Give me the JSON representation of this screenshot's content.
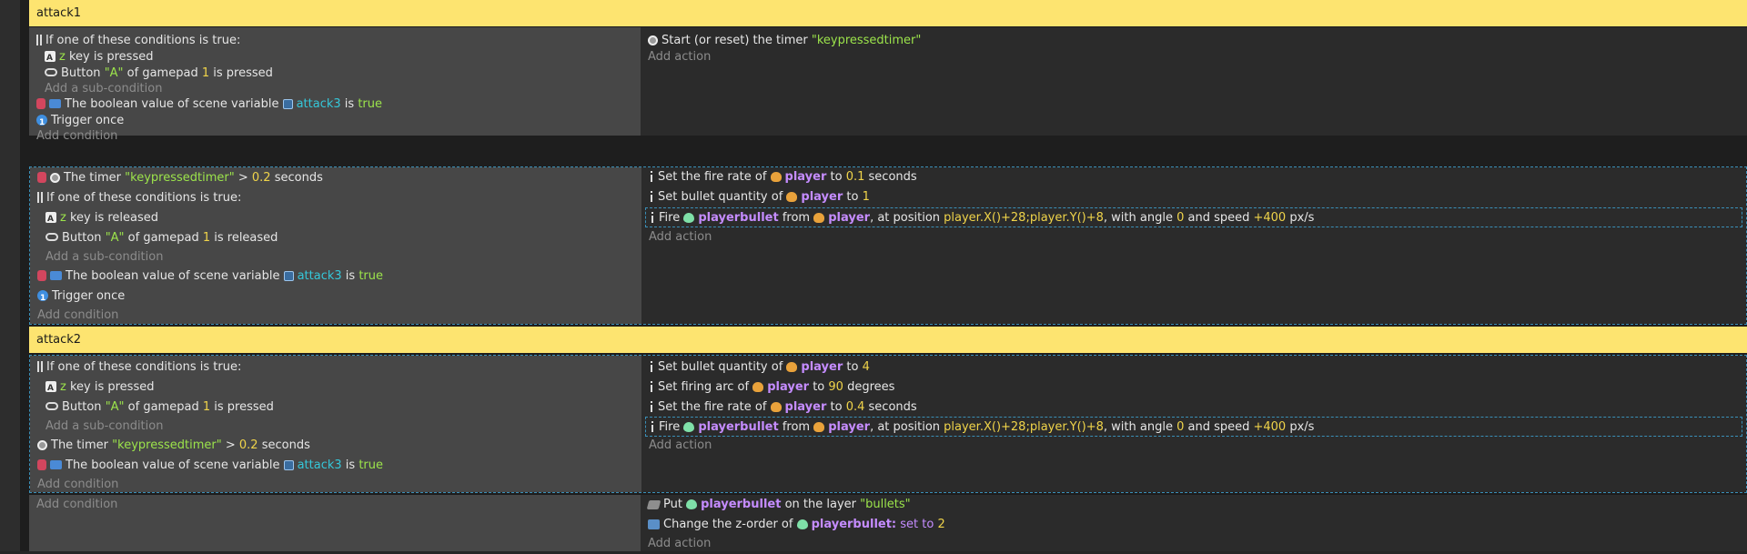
{
  "attack1": {
    "header": "attack1",
    "event1": {
      "or_label": "If one of these conditions is true:",
      "key_name": "z",
      "key_suffix": " key is pressed",
      "pad_prefix": "Button ",
      "pad_button": "\"A\"",
      "pad_mid": " of gamepad ",
      "pad_num": "1",
      "pad_suffix": " is pressed",
      "add_sub": "Add a sub-condition",
      "bool_prefix": "The boolean value of scene variable ",
      "bool_var": "attack3",
      "bool_mid": " is ",
      "bool_val": "true",
      "trigger": "Trigger once",
      "add_cond": "Add condition",
      "action_prefix": "Start (or reset) the timer ",
      "timer_name": "\"keypressedtimer\"",
      "add_action": "Add action"
    },
    "event2": {
      "timer_prefix": "The timer ",
      "timer_name": "\"keypressedtimer\"",
      "timer_op": " > ",
      "timer_val": "0.2",
      "timer_suffix": " seconds",
      "or_label": "If one of these conditions is true:",
      "key_name": "z",
      "key_suffix": " key is released",
      "pad_prefix": "Button ",
      "pad_button": "\"A\"",
      "pad_mid": " of gamepad ",
      "pad_num": "1",
      "pad_suffix": " is released",
      "add_sub": "Add a sub-condition",
      "bool_prefix": "The boolean value of scene variable ",
      "bool_var": "attack3",
      "bool_mid": " is ",
      "bool_val": "true",
      "trigger": "Trigger once",
      "add_cond": "Add condition",
      "a1_prefix": "Set the fire rate of ",
      "a1_obj": "player",
      "a1_mid": " to ",
      "a1_val": "0.1",
      "a1_suffix": " seconds",
      "a2_prefix": "Set bullet quantity of ",
      "a2_obj": "player",
      "a2_mid": " to ",
      "a2_val": "1",
      "fire_prefix": "Fire ",
      "fire_bullet": "playerbullet",
      "fire_from": " from ",
      "fire_obj": "player",
      "fire_pos_label": ", at position ",
      "fire_pos": "player.X()+28;player.Y()+8",
      "fire_angle_label": ", with angle ",
      "fire_angle": "0",
      "fire_speed_label": " and speed ",
      "fire_speed": "+400",
      "fire_unit": " px/s",
      "add_action": "Add action"
    }
  },
  "attack2": {
    "header": "attack2",
    "event1": {
      "or_label": "If one of these conditions is true:",
      "key_name": "z",
      "key_suffix": " key is pressed",
      "pad_prefix": "Button ",
      "pad_button": "\"A\"",
      "pad_mid": " of gamepad ",
      "pad_num": "1",
      "pad_suffix": " is pressed",
      "add_sub": "Add a sub-condition",
      "timer_prefix": "The timer ",
      "timer_name": "\"keypressedtimer\"",
      "timer_op": " > ",
      "timer_val": "0.2",
      "timer_suffix": " seconds",
      "bool_prefix": "The boolean value of scene variable ",
      "bool_var": "attack3",
      "bool_mid": " is ",
      "bool_val": "true",
      "add_cond": "Add condition",
      "a1_prefix": "Set bullet quantity of ",
      "a1_obj": "player",
      "a1_mid": " to ",
      "a1_val": "4",
      "a2_prefix": "Set firing arc of ",
      "a2_obj": "player",
      "a2_mid": " to ",
      "a2_val": "90",
      "a2_suffix": " degrees",
      "a3_prefix": "Set the fire rate of ",
      "a3_obj": "player",
      "a3_mid": " to ",
      "a3_val": "0.4",
      "a3_suffix": " seconds",
      "fire_prefix": "Fire ",
      "fire_bullet": "playerbullet",
      "fire_from": " from ",
      "fire_obj": "player",
      "fire_pos_label": ", at position ",
      "fire_pos": "player.X()+28;player.Y()+8",
      "fire_angle_label": ", with angle ",
      "fire_angle": "0",
      "fire_speed_label": " and speed ",
      "fire_speed": "+400",
      "fire_unit": " px/s",
      "add_action": "Add action"
    },
    "event2": {
      "add_cond": "Add condition",
      "layer_prefix": "Put ",
      "layer_obj": "playerbullet",
      "layer_mid": " on the layer ",
      "layer_name": "\"bullets\"",
      "z_prefix": "Change the z-order of ",
      "z_obj": "playerbullet:",
      "z_op": " set to ",
      "z_val": "2",
      "add_action": "Add action"
    }
  }
}
